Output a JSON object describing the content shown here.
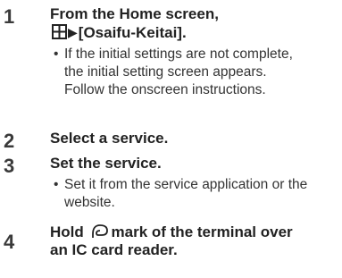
{
  "steps": [
    {
      "number": "1",
      "title_line1": "From the Home screen,",
      "title_line2_arrow": "▶",
      "title_line2_text": "[Osaifu-Keitai].",
      "icon": "grid-menu-icon",
      "note": [
        "If the initial settings are not complete,",
        "the initial setting screen appears.",
        "Follow the onscreen instructions."
      ]
    },
    {
      "number": "2",
      "title": "Select a service."
    },
    {
      "number": "3",
      "title": "Set the service.",
      "note": [
        "Set it from the service application or the",
        "website."
      ]
    },
    {
      "number": "4",
      "title_line1_pre": "Hold",
      "title_line1_post": "mark of the terminal over",
      "title_line2": "an IC card reader.",
      "icon": "felica-mark-icon"
    }
  ],
  "bullet_char": "•"
}
